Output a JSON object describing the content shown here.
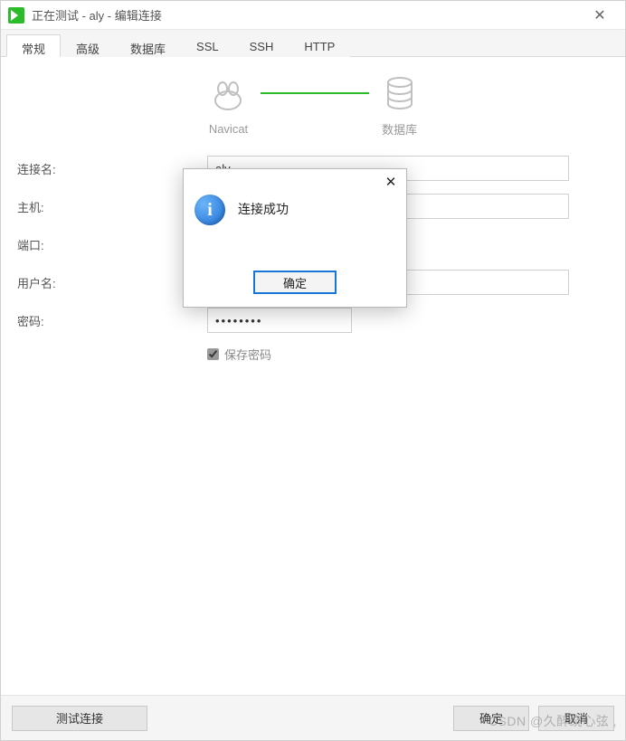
{
  "titlebar": {
    "title": "正在测试 - aly - 编辑连接"
  },
  "tabs": [
    {
      "label": "常规",
      "active": true
    },
    {
      "label": "高级"
    },
    {
      "label": "数据库"
    },
    {
      "label": "SSL"
    },
    {
      "label": "SSH"
    },
    {
      "label": "HTTP"
    }
  ],
  "diagram": {
    "left_label": "Navicat",
    "right_label": "数据库"
  },
  "form": {
    "conn_name_label": "连接名:",
    "conn_name_value": "aly",
    "host_label": "主机:",
    "host_value": "",
    "port_label": "端口:",
    "port_value": "",
    "user_label": "用户名:",
    "user_value": "",
    "pwd_label": "密码:",
    "pwd_value": "••••••••",
    "save_pwd_label": "保存密码",
    "save_pwd_checked": true
  },
  "footer": {
    "test_label": "测试连接",
    "ok_label": "确定",
    "cancel_label": "取消"
  },
  "modal": {
    "message": "连接成功",
    "ok_label": "确定"
  },
  "watermark": "CSDN @久醉绕心弦 ,"
}
